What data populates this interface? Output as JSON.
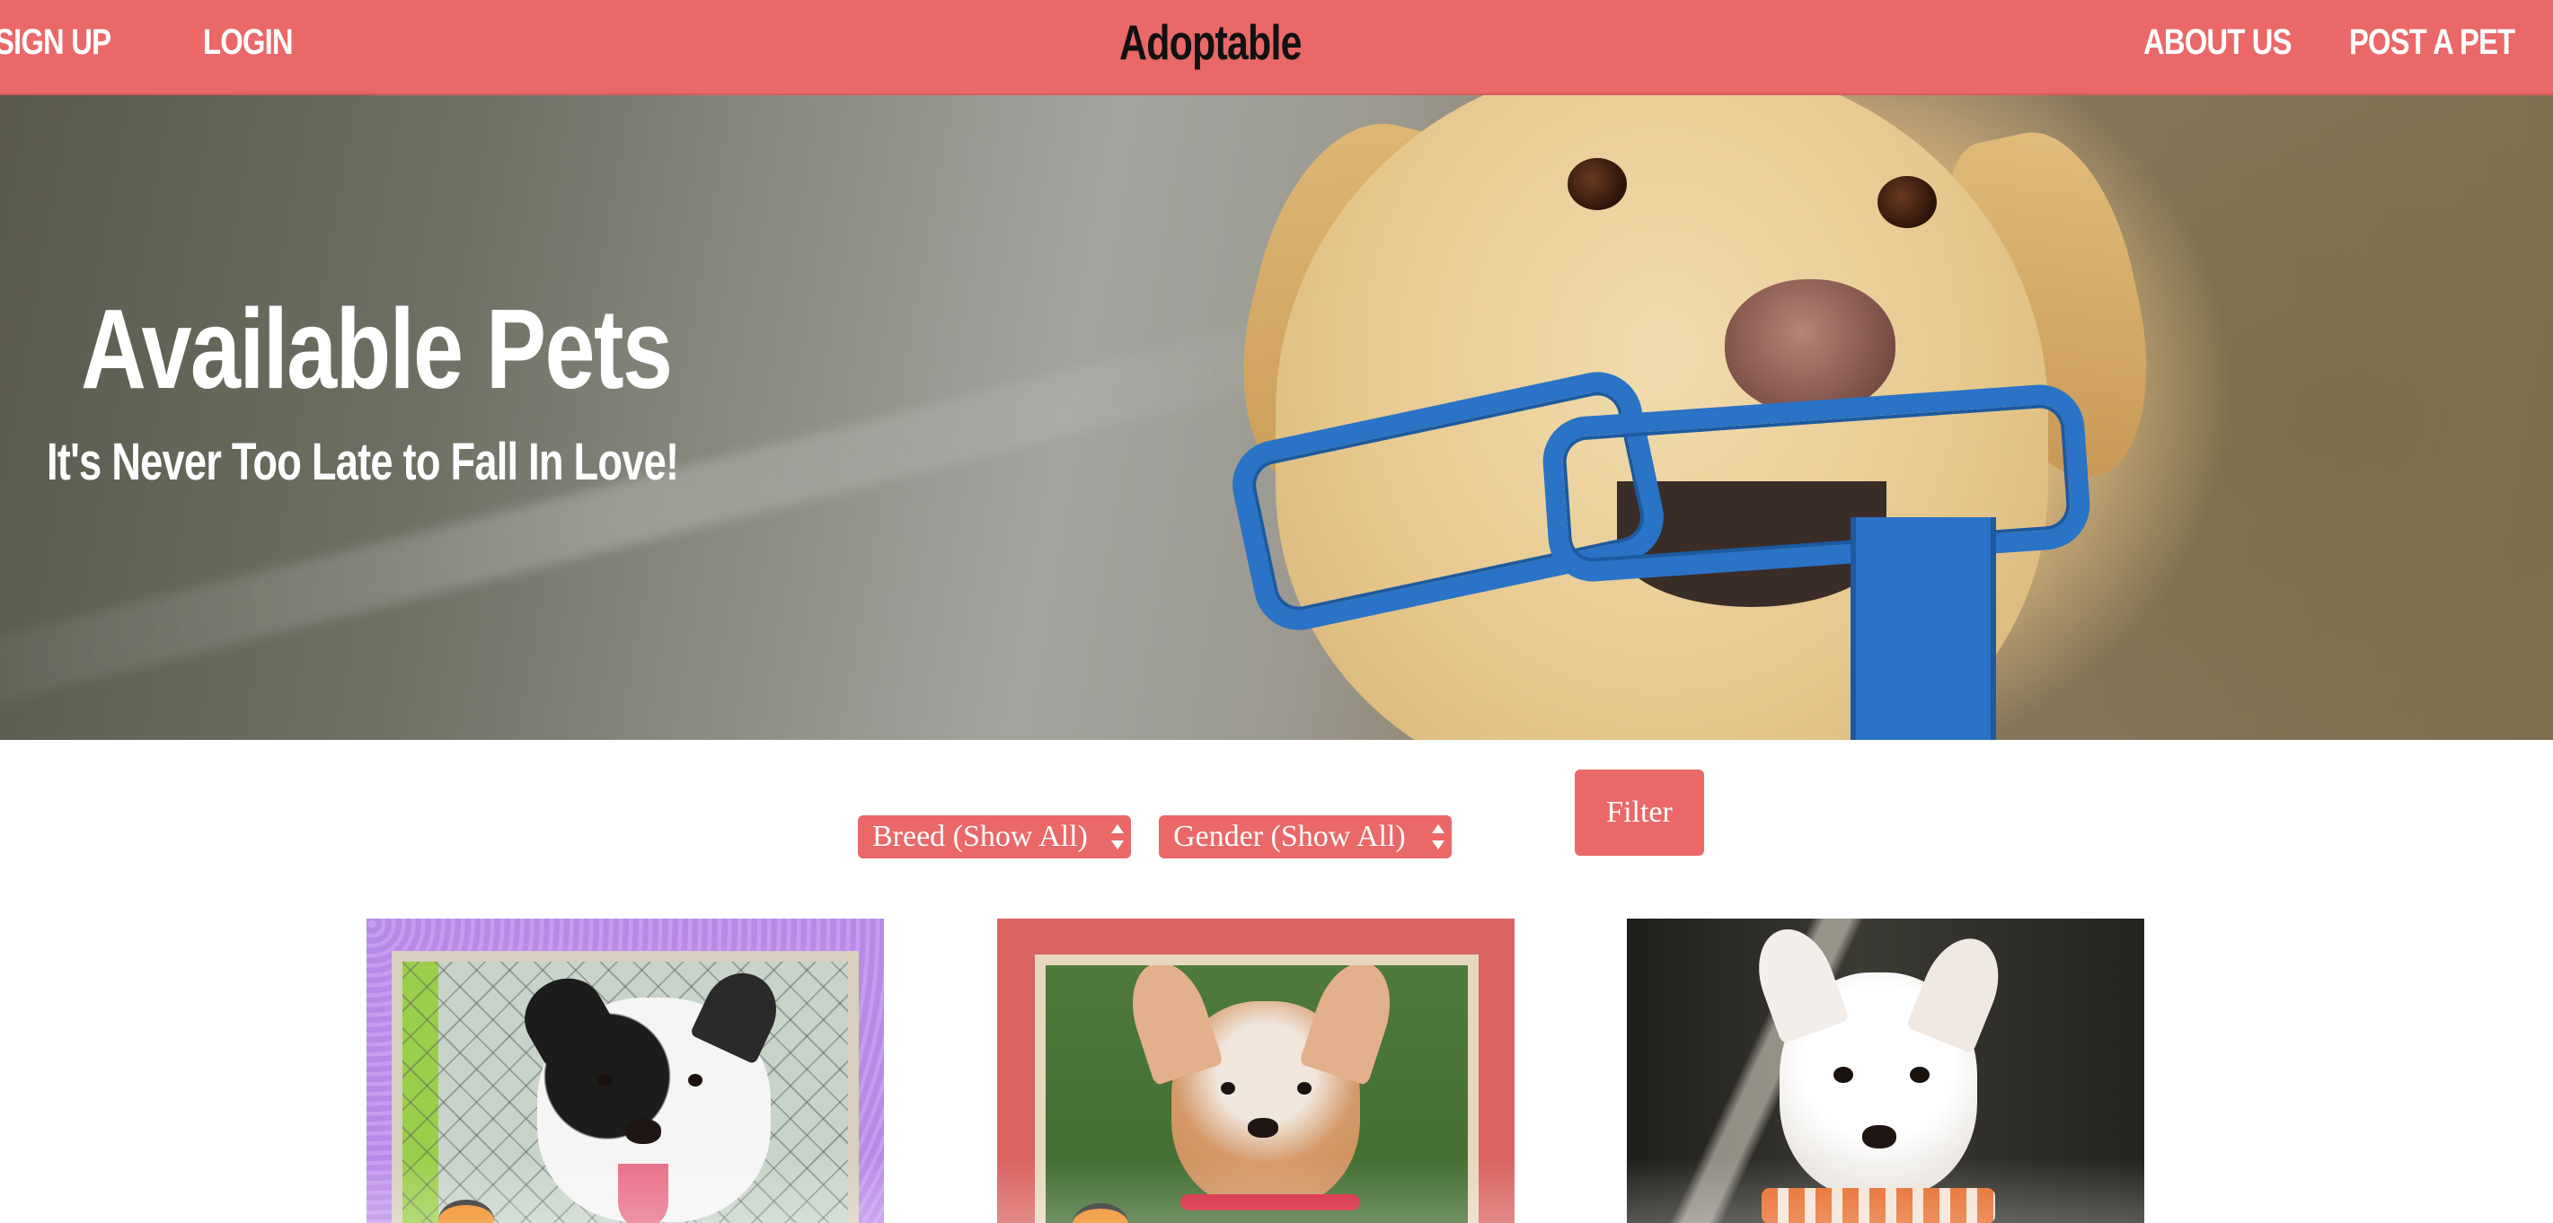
{
  "nav": {
    "signup_label": "SIGN UP",
    "login_label": "LOGIN",
    "brand": "Adoptable",
    "about_label": "ABOUT US",
    "post_label": "POST A PET"
  },
  "hero": {
    "title": "Available Pets",
    "subtitle": "It's Never Too Late to Fall In Love!"
  },
  "filters": {
    "breed_selected": "Breed (Show All)",
    "gender_selected": "Gender (Show All)",
    "filter_button_label": "Filter"
  },
  "colors": {
    "brand": "#ea6868",
    "nav_text": "#ffffff",
    "brand_text": "#111111"
  },
  "pet_cards": [
    {
      "frame": "purple patterned frame",
      "photo_icon": "black-and-white-dog-photo"
    },
    {
      "frame": "red frame",
      "photo_icon": "chihuahua-with-red-collar-photo"
    },
    {
      "frame": "none",
      "photo_icon": "white-chihuahua-with-bandana-photo"
    }
  ]
}
